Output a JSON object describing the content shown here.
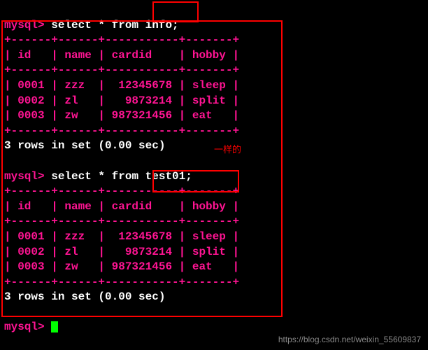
{
  "prompt": "mysql>",
  "query1": {
    "prefix": "select * from ",
    "table": "info;",
    "header_sep": "+------+------+-----------+-------+",
    "row_sep": "+------+------+-----------+-------+",
    "headers": "| id   | name | cardid    | hobby |",
    "rows": [
      "| 0001 | zzz  |  12345678 | sleep |",
      "| 0002 | zl   |   9873214 | split |",
      "| 0003 | zw   | 987321456 | eat   |"
    ],
    "footer": "3 rows in set (0.00 sec)"
  },
  "annotation": "一样的",
  "query2": {
    "prefix": "select * from ",
    "table": "test01;",
    "header_sep": "+------+------+-----------+-------+",
    "row_sep": "+------+------+-----------+-------+",
    "headers": "| id   | name | cardid    | hobby |",
    "rows": [
      "| 0001 | zzz  |  12345678 | sleep |",
      "| 0002 | zl   |   9873214 | split |",
      "| 0003 | zw   | 987321456 | eat   |"
    ],
    "footer": "3 rows in set (0.00 sec)"
  },
  "watermark": "https://blog.csdn.net/weixin_55609837",
  "chart_data": {
    "type": "table",
    "tables": [
      {
        "name": "info",
        "columns": [
          "id",
          "name",
          "cardid",
          "hobby"
        ],
        "rows": [
          [
            "0001",
            "zzz",
            "12345678",
            "sleep"
          ],
          [
            "0002",
            "zl",
            "9873214",
            "split"
          ],
          [
            "0003",
            "zw",
            "987321456",
            "eat"
          ]
        ],
        "summary": "3 rows in set (0.00 sec)"
      },
      {
        "name": "test01",
        "columns": [
          "id",
          "name",
          "cardid",
          "hobby"
        ],
        "rows": [
          [
            "0001",
            "zzz",
            "12345678",
            "sleep"
          ],
          [
            "0002",
            "zl",
            "9873214",
            "split"
          ],
          [
            "0003",
            "zw",
            "987321456",
            "eat"
          ]
        ],
        "summary": "3 rows in set (0.00 sec)"
      }
    ]
  }
}
